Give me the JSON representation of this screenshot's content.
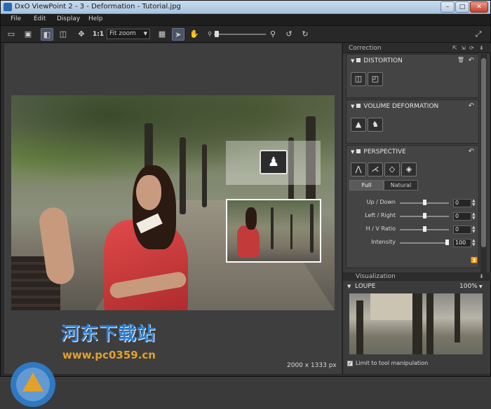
{
  "window": {
    "title": "DxO ViewPoint 2 - 3 - Deformation - Tutorial.jpg",
    "controls": {
      "minimize": "–",
      "maximize": "□",
      "close": "✕"
    }
  },
  "menu": {
    "items": [
      "File",
      "Edit",
      "Display",
      "Help"
    ]
  },
  "toolbar": {
    "ratio_label": "1:1",
    "zoom_value": "Fit zoom",
    "icons": [
      "open-icon",
      "save-icon",
      "compare-single-icon",
      "compare-split-icon",
      "move-icon",
      "grid-icon",
      "pointer-icon",
      "hand-icon",
      "zoom-out-icon",
      "zoom-in-icon",
      "rotate-left-icon",
      "rotate-right-icon",
      "fullscreen-icon"
    ],
    "zoom_slider_fraction": 0.02
  },
  "viewer": {
    "image_size": "2000 x 1333 px"
  },
  "watermark": {
    "text": "河东下载站",
    "url": "www.pc0359.cn"
  },
  "panel": {
    "title": "Correction",
    "sections": {
      "distortion": {
        "title": "DISTORTION"
      },
      "volume": {
        "title": "VOLUME DEFORMATION"
      },
      "perspective": {
        "title": "PERSPECTIVE",
        "modes": [
          "Full",
          "Natural"
        ],
        "selected_mode": "Full",
        "params": [
          {
            "label": "Up / Down",
            "value": "0",
            "fraction": 0.5
          },
          {
            "label": "Left / Right",
            "value": "0",
            "fraction": 0.5
          },
          {
            "label": "H / V Ratio",
            "value": "0",
            "fraction": 0.5
          },
          {
            "label": "Intensity",
            "value": "100",
            "fraction": 1.0
          }
        ]
      }
    },
    "visualization": {
      "title": "Visualization",
      "loupe_label": "LOUPE",
      "loupe_zoom": "100%",
      "checkbox_label": "Limit to tool manipulation",
      "checkbox_checked": true
    }
  },
  "colors": {
    "accent": "#2f7fd1",
    "panel_bg": "#3b3b3b",
    "viewer_bg": "#3e3e3e"
  }
}
